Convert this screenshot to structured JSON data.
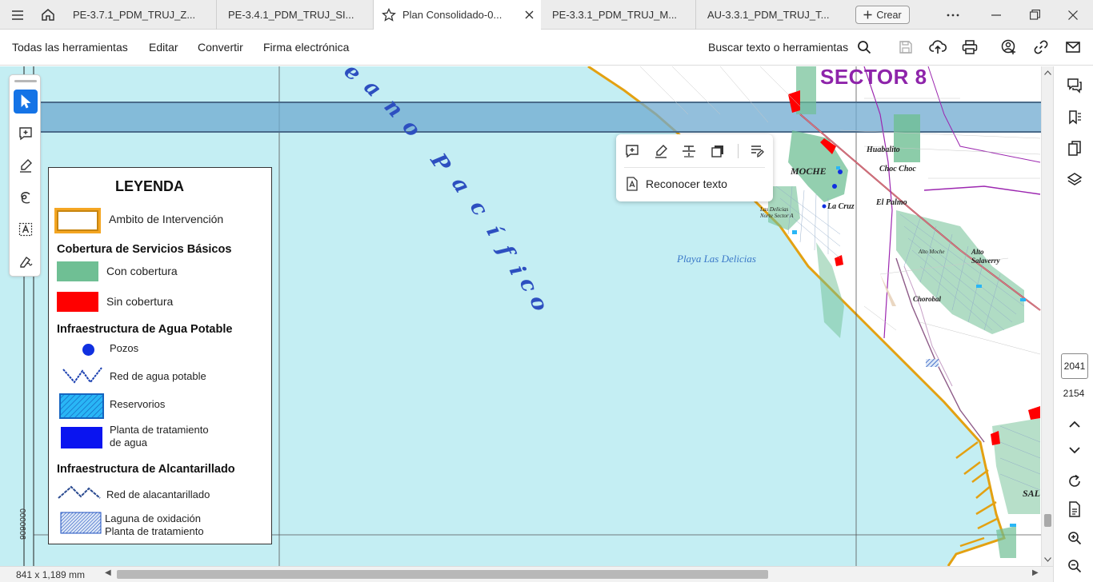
{
  "tabs": [
    {
      "label": "PE-3.7.1_PDM_TRUJ_Z...",
      "active": false
    },
    {
      "label": "PE-3.4.1_PDM_TRUJ_SI...",
      "active": false
    },
    {
      "label": "Plan Consolidado-0...",
      "active": true
    },
    {
      "label": "PE-3.3.1_PDM_TRUJ_M...",
      "active": false
    },
    {
      "label": "AU-3.3.1_PDM_TRUJ_T...",
      "active": false
    }
  ],
  "create_label": "Crear",
  "menu": [
    "Todas las herramientas",
    "Editar",
    "Convertir",
    "Firma electrónica"
  ],
  "search_label": "Buscar texto o herramientas",
  "map": {
    "sector": "SECTOR 8",
    "coord": "9090000",
    "ocean_letters": [
      "e",
      "a",
      "n",
      "o",
      "P",
      "a",
      "c",
      "í",
      "f",
      "i",
      "c",
      "o"
    ],
    "beach": "Playa Las Delicias",
    "places": {
      "moche": "MOCHE",
      "huabalito": "Huabalito",
      "choc_choc": "Choc Choc",
      "el_palmo": "El Palmo",
      "la_cruz": "La Cruz",
      "alto_salaverry": "Alto Salaverry",
      "chorobal": "Chorobal",
      "las_delicias": "Las Delicias Norte Sector A",
      "alto_moche": "Alto Moche",
      "sal": "SAL"
    }
  },
  "legend": {
    "title": "LEYENDA",
    "ambito": "Ambito de Intervención",
    "cobertura_title": "Cobertura de Servicios Básicos",
    "con_cobertura": "Con cobertura",
    "sin_cobertura": "Sin cobertura",
    "agua_title": "Infraestructura de Agua Potable",
    "pozos": "Pozos",
    "red_agua": "Red de agua potable",
    "reservorios": "Reservorios",
    "planta_agua_1": "Planta de tratamiento",
    "planta_agua_2": "de agua",
    "alcant_title": "Infraestructura de Alcantarillado",
    "red_alcant": "Red de alacantarillado",
    "laguna_1": "Laguna de oxidación",
    "laguna_2": "Planta de tratamiento"
  },
  "context_menu": {
    "recognize": "Reconocer texto"
  },
  "page": {
    "current": "2041",
    "total": "2154"
  },
  "status": {
    "size": "841 x 1,189 mm"
  },
  "colors": {
    "ocean": "#c4eef3",
    "accent": "#1473e6",
    "con_cobertura": "#6fbf94",
    "sin_cobertura": "#ff0000",
    "sector": "#8e24aa",
    "ambito": "#f4a623"
  }
}
